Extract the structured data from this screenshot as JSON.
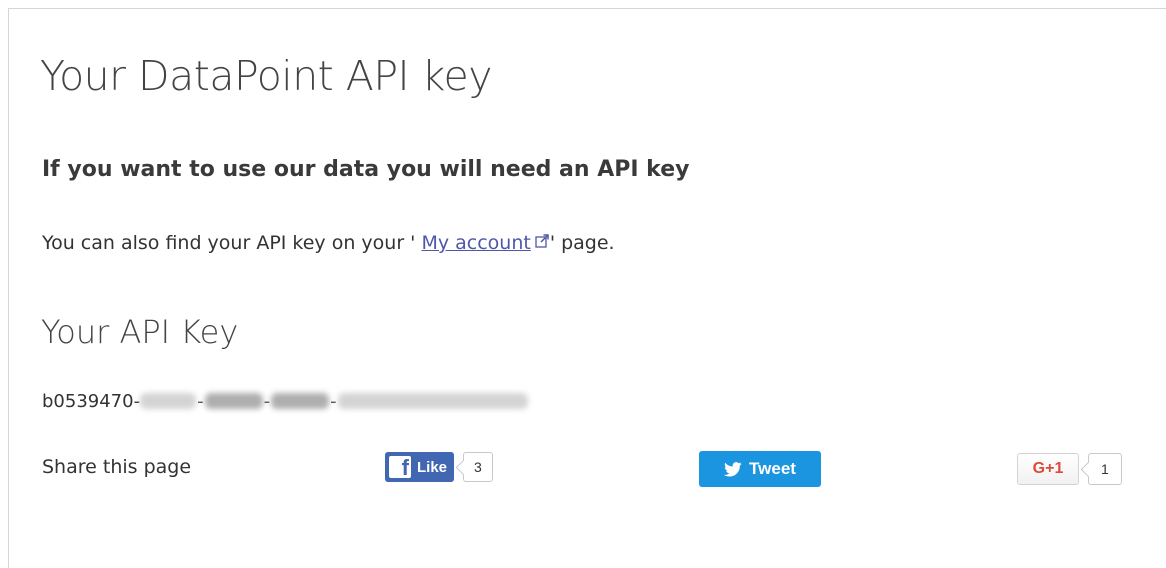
{
  "page": {
    "title": "Your DataPoint API key",
    "subheading": "If you want to use our data you will need an API key",
    "info": {
      "before": "You can also find your API key on your ' ",
      "link_label": "My account",
      "after": "' page."
    }
  },
  "api_key_section": {
    "title": "Your API Key",
    "visible_prefix": "b0539470-",
    "separators": [
      "-",
      "-",
      "-"
    ],
    "redacted": true
  },
  "share": {
    "label": "Share this page",
    "facebook": {
      "button_label": "Like",
      "logo": "f",
      "count": "3",
      "brand_color": "#4267b2"
    },
    "twitter": {
      "button_label": "Tweet",
      "icon": "twitter-bird-icon",
      "brand_color": "#1b95e0"
    },
    "google_plus": {
      "button_label": "G+1",
      "count": "1",
      "brand_color": "#dd4b39"
    }
  },
  "colors": {
    "link": "#4f58a8",
    "text": "#333333"
  }
}
